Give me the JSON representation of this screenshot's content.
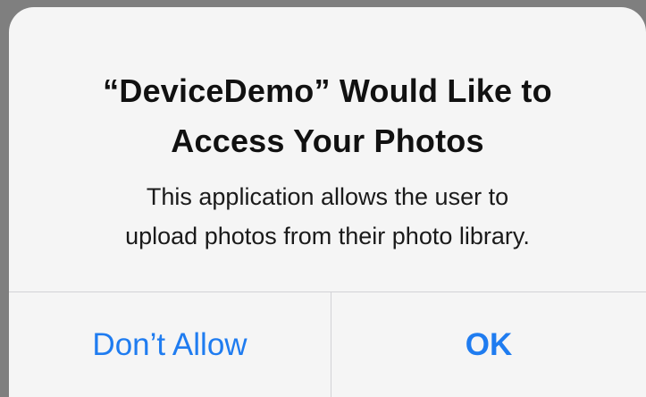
{
  "alert": {
    "title_lines": [
      "“DeviceDemo” Would Like to",
      "Access Your Photos"
    ],
    "message_lines": [
      "This application allows the user to",
      "upload photos from their photo library."
    ],
    "buttons": {
      "deny_label": "Don’t Allow",
      "ok_label": "OK"
    }
  },
  "colors": {
    "accent": "#1f7cf0",
    "alert_background": "#f5f5f5",
    "backdrop": "#7f7f7f",
    "divider": "#d2d2d6"
  }
}
